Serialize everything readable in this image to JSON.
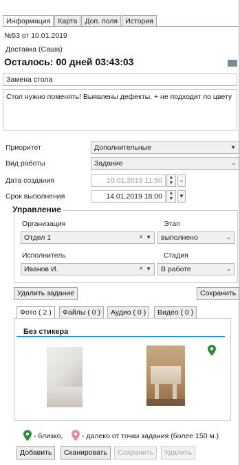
{
  "tabs": [
    "Информация",
    "Карта",
    "Доп. поля",
    "История"
  ],
  "header": {
    "number": "№53 от 10.01.2019",
    "delivery": "Доставка (Саша)",
    "countdown": "Осталось: 00 дней 03:43:03"
  },
  "task": {
    "title": "Замена стола",
    "description": "Стол нужно поменять! Выявлены дефекты. + не подходит по цвету"
  },
  "form": {
    "priority_label": "Приоритет",
    "priority_value": "Дополнительные",
    "work_type_label": "Вид работы",
    "work_type_value": "Задание",
    "created_label": "Дата создания",
    "created_value": "10.01.2019 11:50",
    "due_label": "Срок выполнения",
    "due_value": "14.01.2019 18:00"
  },
  "management": {
    "legend": "Управление",
    "org_label": "Организация",
    "org_value": "Отдел 1",
    "stage_label": "Этап",
    "stage_value": "выполнено",
    "executor_label": "Исполнитель",
    "executor_value": "Иванов И.",
    "status_label": "Стадия",
    "status_value": "В работе"
  },
  "actions": {
    "delete": "Удалить задание",
    "save": "Сохранить"
  },
  "media_tabs": [
    "Фото ( 2 )",
    "Файлы ( 0 )",
    "Аудио ( 0 )",
    "Видео ( 0 )"
  ],
  "media": {
    "group": "Без стикера",
    "legend_near": "- близко,",
    "legend_far": "- далеко от точки задания (более 150 м.)"
  },
  "bottom_buttons": [
    "Добавить",
    "Сканировать",
    "Сохранить",
    "Удалить"
  ],
  "icons": {
    "near_pin": "map-pin-green-icon",
    "far_pin": "map-pin-pink-icon"
  },
  "colors": {
    "near": "#2e8b3a",
    "far": "#e58aa0",
    "accent": "#1e90ff"
  }
}
